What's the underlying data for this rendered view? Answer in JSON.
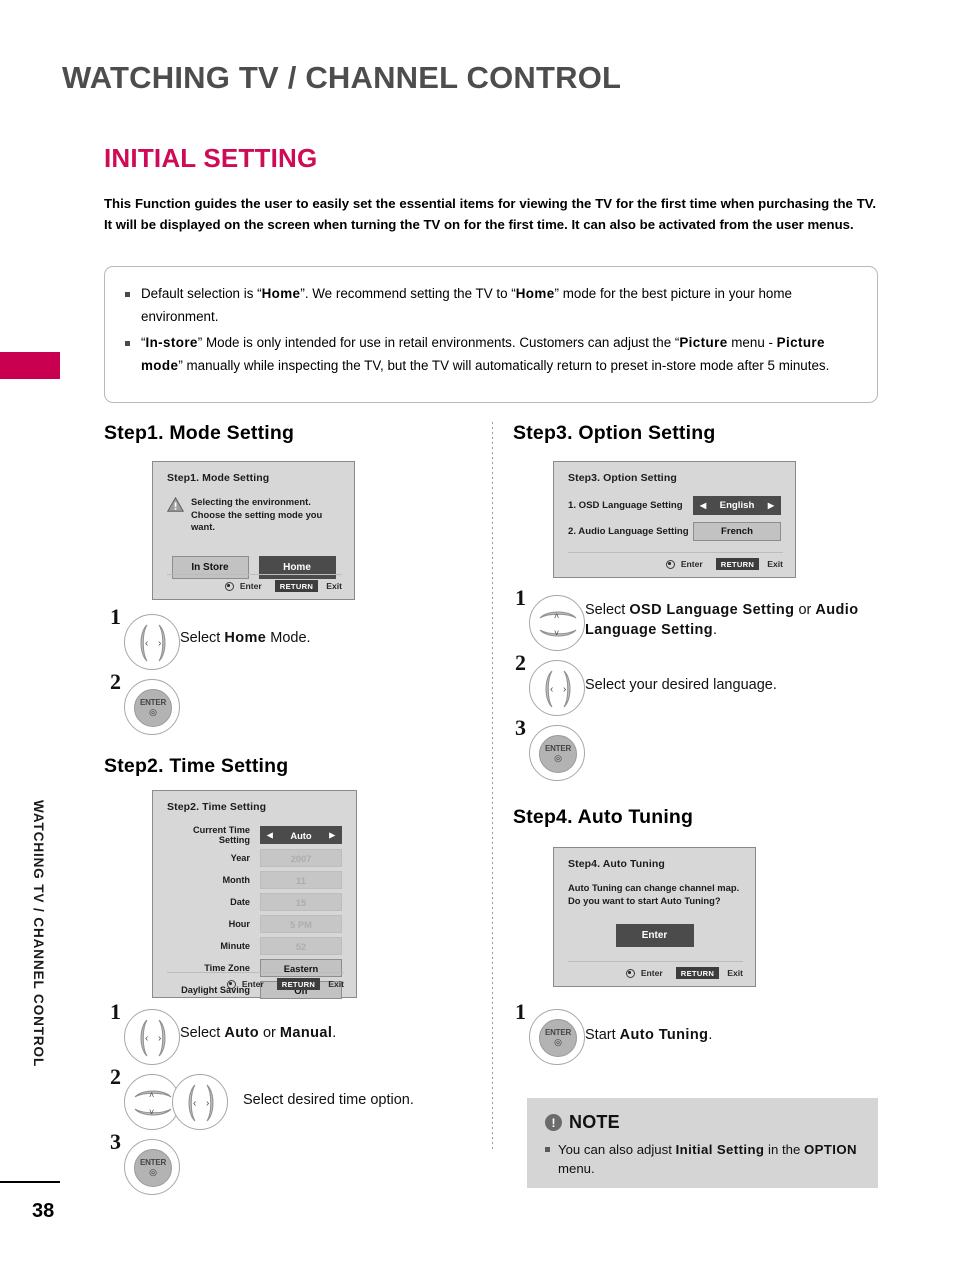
{
  "page": {
    "header_title": "WATCHING TV / CHANNEL CONTROL",
    "section_title": "INITIAL SETTING",
    "side_tab_label": "WATCHING TV / CHANNEL CONTROL",
    "page_number": "38"
  },
  "intro": {
    "text": "This Function guides the user to easily set the essential items for viewing the TV for the first time when purchasing the TV. It will be displayed on the screen when turning the TV on for the first time. It can also be activated from the user menus."
  },
  "callout": {
    "bullets": [
      {
        "parts": [
          {
            "t": "Default selection is “",
            "b": false
          },
          {
            "t": "Home",
            "b": true
          },
          {
            "t": "”. We recommend setting the TV to “",
            "b": false
          },
          {
            "t": "Home",
            "b": true
          },
          {
            "t": "” mode for the best picture in your home environment.",
            "b": false
          }
        ]
      },
      {
        "parts": [
          {
            "t": "“",
            "b": false
          },
          {
            "t": "In-store",
            "b": true
          },
          {
            "t": "” Mode is only intended for use in retail environments. Customers can adjust the “",
            "b": false
          },
          {
            "t": "Picture",
            "b": true
          },
          {
            "t": " menu - ",
            "b": false
          },
          {
            "t": "Picture mode",
            "b": true
          },
          {
            "t": "” manually while inspecting the TV, but the TV will automatically return to preset in-store mode after 5 minutes.",
            "b": false
          }
        ]
      }
    ]
  },
  "steps": {
    "step1": {
      "heading": "Step1. Mode Setting",
      "dialog": {
        "title": "Step1. Mode Setting",
        "warn_icon": "warning-triangle-icon",
        "message_line1": "Selecting the environment.",
        "message_line2": "Choose the setting mode you want.",
        "buttons": [
          {
            "label": "In Store",
            "selected": false
          },
          {
            "label": "Home",
            "selected": true
          }
        ],
        "footer": {
          "enter": "Enter",
          "return": "RETURN",
          "exit": "Exit"
        }
      },
      "actions": [
        {
          "num": "1",
          "key": "left-right-key",
          "text_parts": [
            {
              "t": "Select ",
              "b": false
            },
            {
              "t": "Home",
              "b": true
            },
            {
              "t": " Mode.",
              "b": false
            }
          ]
        },
        {
          "num": "2",
          "key": "enter-key",
          "text_parts": []
        }
      ]
    },
    "step2": {
      "heading": "Step2. Time Setting",
      "dialog": {
        "title": "Step2. Time Setting",
        "rows": [
          {
            "label": "Current Time Setting",
            "value": "Auto",
            "state": "selected",
            "arrows": true
          },
          {
            "label": "Year",
            "value": "2007",
            "state": "disabled",
            "arrows": false
          },
          {
            "label": "Month",
            "value": "11",
            "state": "disabled",
            "arrows": false
          },
          {
            "label": "Date",
            "value": "15",
            "state": "disabled",
            "arrows": false
          },
          {
            "label": "Hour",
            "value": "5 PM",
            "state": "disabled",
            "arrows": false
          },
          {
            "label": "Minute",
            "value": "52",
            "state": "disabled",
            "arrows": false
          },
          {
            "label": "Time Zone",
            "value": "Eastern",
            "state": "normal",
            "arrows": false
          },
          {
            "label": "Daylight Saving",
            "value": "Off",
            "state": "normal",
            "arrows": false
          }
        ],
        "footer": {
          "enter": "Enter",
          "return": "RETURN",
          "exit": "Exit"
        }
      },
      "actions": [
        {
          "num": "1",
          "key": "left-right-key",
          "text_parts": [
            {
              "t": "Select ",
              "b": false
            },
            {
              "t": "Auto",
              "b": true
            },
            {
              "t": " or ",
              "b": false
            },
            {
              "t": "Manual",
              "b": true
            },
            {
              "t": ".",
              "b": false
            }
          ]
        },
        {
          "num": "2",
          "key": "up-down-key+left-right-key",
          "text_parts": [
            {
              "t": "Select desired time option.",
              "b": false
            }
          ]
        },
        {
          "num": "3",
          "key": "enter-key",
          "text_parts": []
        }
      ]
    },
    "step3": {
      "heading": "Step3. Option Setting",
      "dialog": {
        "title": "Step3. Option Setting",
        "rows": [
          {
            "label": "1. OSD Language Setting",
            "value": "English",
            "state": "selected",
            "arrows": true
          },
          {
            "label": "2. Audio Language Setting",
            "value": "French",
            "state": "normal",
            "arrows": false
          }
        ],
        "footer": {
          "enter": "Enter",
          "return": "RETURN",
          "exit": "Exit"
        }
      },
      "actions": [
        {
          "num": "1",
          "key": "up-down-key",
          "text_parts": [
            {
              "t": "Select ",
              "b": false
            },
            {
              "t": "OSD Language Setting",
              "b": true
            },
            {
              "t": " or ",
              "b": false
            },
            {
              "t": "Audio Language Setting",
              "b": true
            },
            {
              "t": ".",
              "b": false
            }
          ]
        },
        {
          "num": "2",
          "key": "left-right-key",
          "text_parts": [
            {
              "t": "Select your desired language.",
              "b": false
            }
          ]
        },
        {
          "num": "3",
          "key": "enter-key",
          "text_parts": []
        }
      ]
    },
    "step4": {
      "heading": "Step4. Auto Tuning",
      "dialog": {
        "title": "Step4. Auto Tuning",
        "message_line1": "Auto Tuning can change channel map.",
        "message_line2": "Do you want to start Auto Tuning?",
        "button": {
          "label": "Enter",
          "selected": true
        },
        "footer": {
          "enter": "Enter",
          "return": "RETURN",
          "exit": "Exit"
        }
      },
      "actions": [
        {
          "num": "1",
          "key": "enter-key",
          "text_parts": [
            {
              "t": "Start ",
              "b": false
            },
            {
              "t": "Auto Tuning",
              "b": true
            },
            {
              "t": ".",
              "b": false
            }
          ]
        }
      ]
    }
  },
  "note": {
    "icon": "exclamation-icon",
    "title": "NOTE",
    "body_parts": [
      {
        "t": "You can also adjust ",
        "b": false
      },
      {
        "t": "Initial Setting",
        "b": true
      },
      {
        "t": " in the ",
        "b": false
      },
      {
        "t": "OPTION",
        "b": true
      },
      {
        "t": " menu.",
        "b": false
      }
    ]
  },
  "keys": {
    "enter_label": "ENTER",
    "left_glyph": "‹",
    "right_glyph": "›",
    "up_glyph": "˄",
    "down_glyph": "˅"
  },
  "colors": {
    "accent_magenta": "#c8004f",
    "section_pink": "#cf0a57",
    "header_gray": "#4d4d4d",
    "osd_bg": "#d7d7d7",
    "osd_selected": "#4b4b4b",
    "note_bg": "#d5d5d5"
  }
}
